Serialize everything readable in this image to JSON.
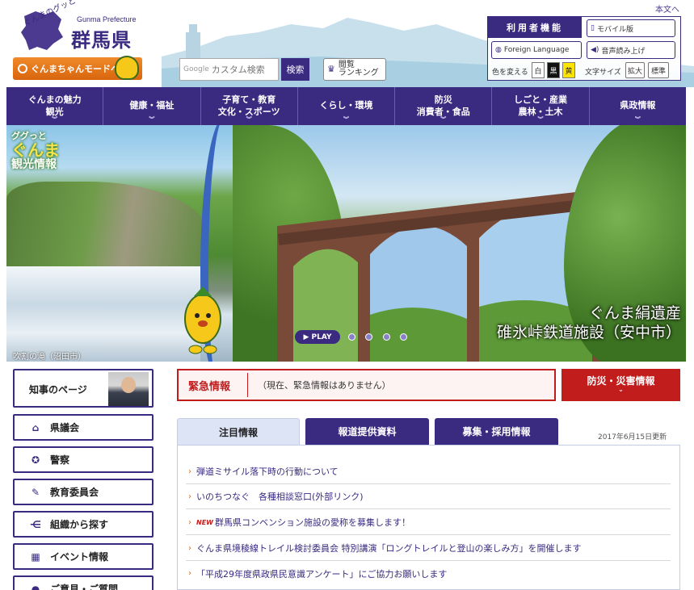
{
  "header": {
    "skip_link": "本文へ",
    "logo_tagline": "ぐんまのグッと",
    "pref_en": "Gunma Prefecture",
    "pref_jp": "群馬県",
    "mode_button": "ぐんまちゃんモードへ",
    "search_brand": "Google",
    "search_placeholder": "カスタム検索",
    "search_button": "検索",
    "ranking_line1": "閲覧",
    "ranking_line2": "ランキング"
  },
  "tools": {
    "title": "利用者機能",
    "mobile": "モバイル版",
    "foreign": "Foreign Language",
    "voice": "音声読み上げ",
    "color_label": "色を変える",
    "color_white": "白",
    "color_black": "黒",
    "color_yellow": "黄",
    "text_size_label": "文字サイズ",
    "enlarge": "拡大",
    "standard": "標準"
  },
  "nav": [
    {
      "line1": "ぐんまの魅力",
      "line2": "観光"
    },
    {
      "line1": "健康・福祉",
      "line2": ""
    },
    {
      "line1": "子育て・教育",
      "line2": "文化・スポーツ"
    },
    {
      "line1": "くらし・環境",
      "line2": ""
    },
    {
      "line1": "防災",
      "line2": "消費者・食品"
    },
    {
      "line1": "しごと・産業",
      "line2": "農林・土木"
    },
    {
      "line1": "県政情報",
      "line2": ""
    }
  ],
  "hero": {
    "tag_line1": "ググっと",
    "tag_line2": "ぐんま",
    "tag_line3": "観光情報",
    "left_caption": "吹割の滝（沼田市）",
    "right_caption_line1": "ぐんま絹遺産",
    "right_caption_line2": "碓氷峠鉄道施設（安中市）",
    "play_label": "PLAY"
  },
  "side": {
    "governor": "知事のページ",
    "links": [
      {
        "icon": "building-icon",
        "glyph": "🏛",
        "label": "県議会"
      },
      {
        "icon": "police-badge-icon",
        "glyph": "✪",
        "label": "警察"
      },
      {
        "icon": "pen-icon",
        "glyph": "✎",
        "label": "教育委員会"
      },
      {
        "icon": "org-chart-icon",
        "glyph": "⋲",
        "label": "組織から探す"
      },
      {
        "icon": "calendar-icon",
        "glyph": "▦",
        "label": "イベント情報"
      },
      {
        "icon": "chat-icon",
        "glyph": "💬",
        "label": "ご意見・ご質問"
      }
    ]
  },
  "emergency": {
    "title": "緊急情報",
    "message": "（現在、緊急情報はありません）",
    "disaster_button": "防災・災害情報"
  },
  "tabs": {
    "featured": "注目情報",
    "press": "報道提供資料",
    "recruit": "募集・採用情報",
    "updated": "2017年6月15日更新"
  },
  "news": [
    {
      "new": "",
      "text": "弾道ミサイル落下時の行動について"
    },
    {
      "new": "",
      "text": "いのちつなぐ　各種相談窓口(外部リンク)"
    },
    {
      "new": "NEW",
      "text": "群馬県コンベンション施設の愛称を募集します！"
    },
    {
      "new": "",
      "text": "ぐんま県境稜線トレイル検討委員会 特別講演「ロングトレイルと登山の楽しみ方」を開催します"
    },
    {
      "new": "",
      "text": "「平成29年度県政県民意識アンケート」にご協力お願いします"
    }
  ],
  "colors": {
    "brand": "#3a2a80",
    "accent_orange": "#d8650e",
    "alert_red": "#c21d1d"
  }
}
